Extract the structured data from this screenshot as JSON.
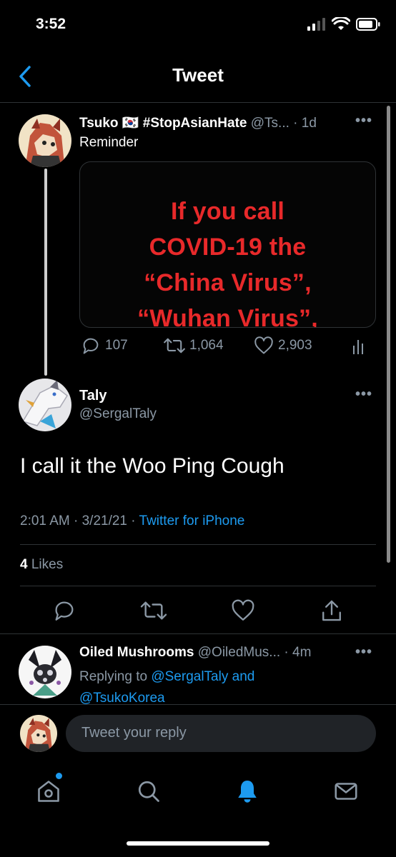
{
  "status_bar": {
    "time": "3:52"
  },
  "nav": {
    "title": "Tweet"
  },
  "parent_tweet": {
    "name": "Tsuko",
    "flag": "🇰🇷",
    "name_tag": "#StopAsianHate",
    "handle": "@Ts...",
    "time": "· 1d",
    "text": "Reminder",
    "image_text": [
      "If you call",
      "COVID-19 the",
      "“China Virus”,",
      "“Wuhan Virus”,"
    ],
    "replies": "107",
    "retweets": "1,064",
    "likes": "2,903"
  },
  "main_tweet": {
    "name": "Taly",
    "handle": "@SergalTaly",
    "text": "I call it the Woo Ping Cough",
    "time": "2:01 AM · 3/21/21 · ",
    "source": "Twitter for iPhone",
    "likes_count": "4",
    "likes_label": "Likes"
  },
  "reply_tweet": {
    "name": "Oiled Mushrooms",
    "handle": "@OiledMus...",
    "time": "· 4m",
    "replying_prefix": "Replying to ",
    "replying_to_1": "@SergalTaly",
    "replying_and": " and",
    "replying_to_2": "@TsukoKorea"
  },
  "composer": {
    "placeholder": "Tweet your reply"
  },
  "colors": {
    "accent": "#1d9bf0",
    "muted": "#8b98a5",
    "warning_red": "#e8292a"
  },
  "icons": [
    "chevron-left-icon",
    "reply-icon",
    "retweet-icon",
    "heart-icon",
    "analytics-icon",
    "share-icon",
    "home-icon",
    "search-icon",
    "bell-icon",
    "mail-icon"
  ]
}
